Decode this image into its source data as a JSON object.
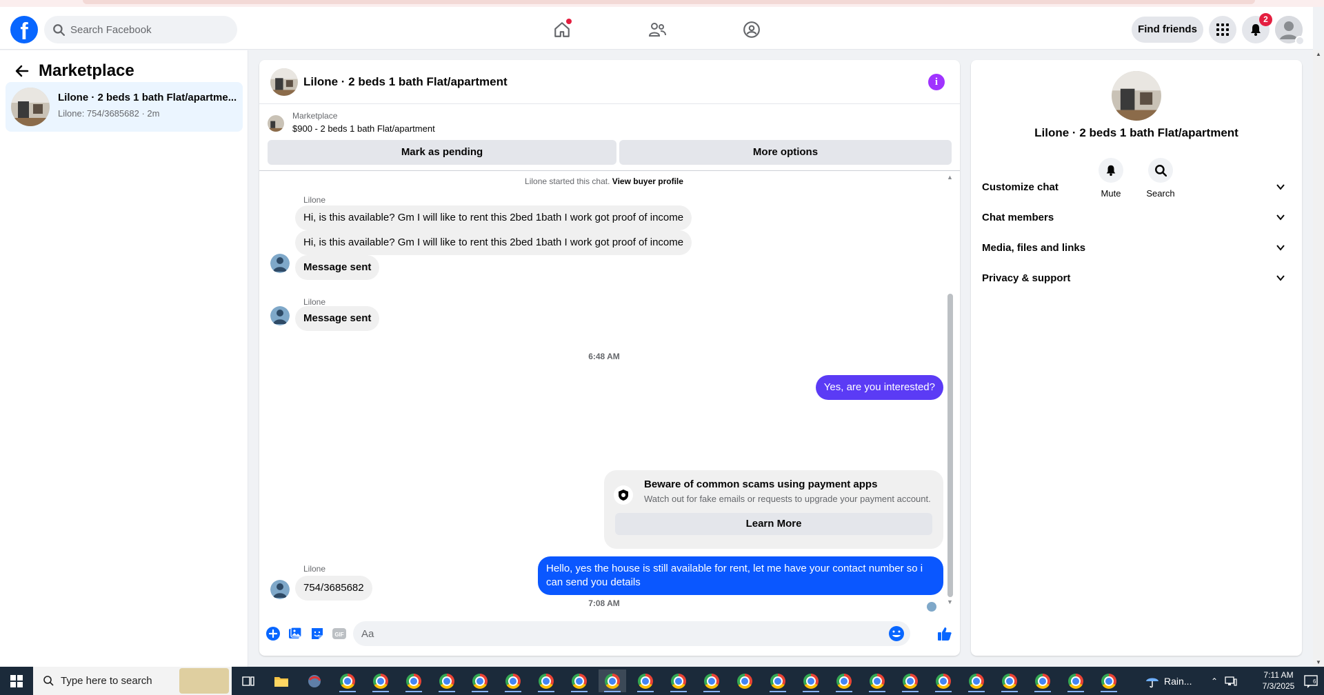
{
  "header": {
    "search_placeholder": "Search Facebook",
    "find_friends_label": "Find friends",
    "notifications_count": "2",
    "accent_color": "#0866ff"
  },
  "sidebar": {
    "title": "Marketplace",
    "conversations": [
      {
        "title": "Lilone · 2 beds 1 bath Flat/apartme...",
        "subtitle": "Lilone: 754/3685682 · 2m"
      }
    ]
  },
  "chat": {
    "title": "Lilone · 2 beds 1 bath Flat/apartment",
    "listing_category": "Marketplace",
    "listing_detail": "$900 - 2 beds 1 bath Flat/apartment",
    "mark_pending_label": "Mark as pending",
    "more_options_label": "More options",
    "started_text": "Lilone started this chat.",
    "view_profile_label": "View buyer profile",
    "sender_name": "Lilone",
    "messages": {
      "in_1": "Hi, is this available? Gm I will like to rent this 2bed  1bath I work got proof of income",
      "in_2": "Hi, is this available? Gm I will like to rent this 2bed  1bath I work got proof of income",
      "in_3": "Message sent",
      "in_4": "Message sent",
      "time_1": "6:48 AM",
      "out_1": "Yes, are you interested?",
      "out_2": "Hello, yes the house is still available for rent, let me have your contact number so i can send you details",
      "time_2": "7:08 AM",
      "in_5": "754/3685682"
    },
    "warning": {
      "title": "Beware of common scams using payment apps",
      "subtitle": "Watch out for fake emails or requests to upgrade your payment account.",
      "button": "Learn More"
    },
    "composer_placeholder": "Aa",
    "outgoing_color": "#0a57ff",
    "outgoing_color_alt": "#5b3bf5"
  },
  "details": {
    "title": "Lilone · 2 beds 1 bath Flat/apartment",
    "actions": [
      "Mute",
      "Search"
    ],
    "sections": [
      "Customize chat",
      "Chat members",
      "Media, files and links",
      "Privacy & support"
    ]
  },
  "taskbar": {
    "search_text": "Type here to search",
    "weather": "Rain...",
    "time": "7:11 AM",
    "date": "7/3/2025"
  }
}
